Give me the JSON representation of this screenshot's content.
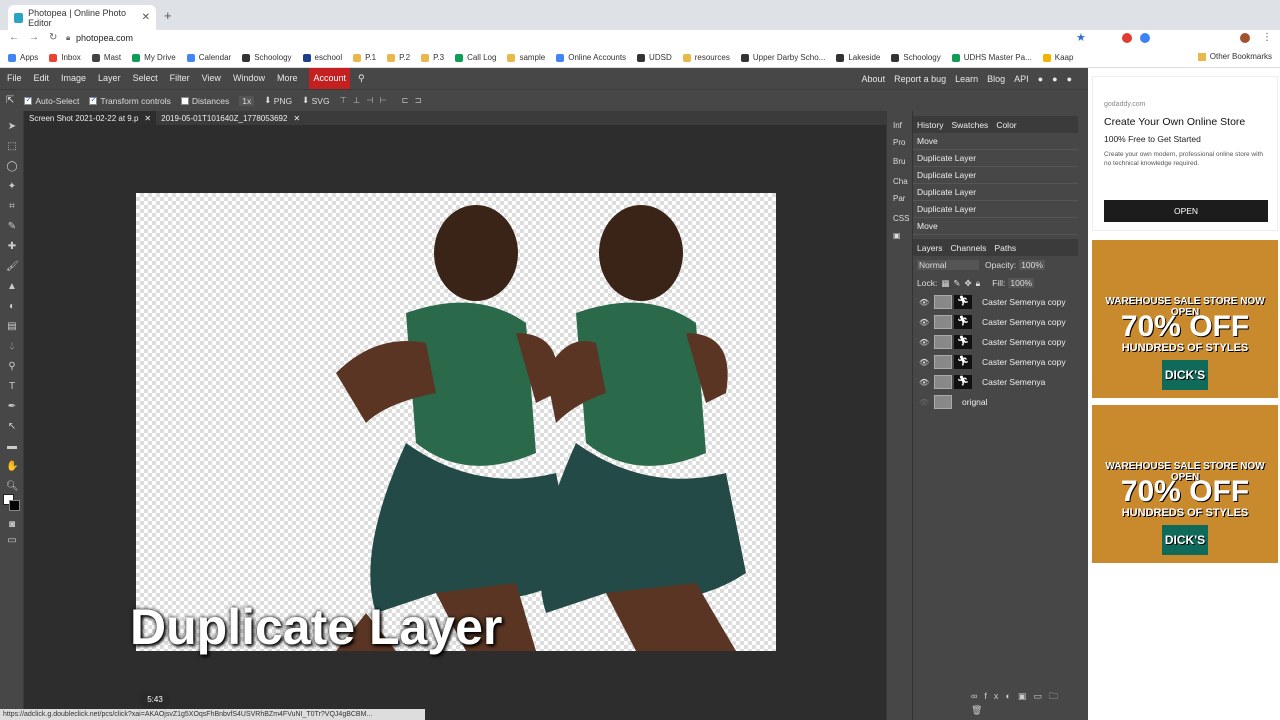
{
  "browser": {
    "tab_title": "Photopea | Online Photo Editor",
    "url": "photopea.com"
  },
  "bookmarks": [
    "Apps",
    "Inbox",
    "Mast",
    "My Drive",
    "Calendar",
    "Schoology",
    "eschool",
    "P.1",
    "P.2",
    "P.3",
    "Call Log",
    "sample",
    "Online Accounts",
    "UDSD",
    "resources",
    "Upper Darby Scho...",
    "Lakeside",
    "Schoology",
    "UDHS Master Pa...",
    "Kaap"
  ],
  "bookmarks_other": "Other Bookmarks",
  "menu": {
    "items": [
      "File",
      "Edit",
      "Image",
      "Layer",
      "Select",
      "Filter",
      "View",
      "Window",
      "More"
    ],
    "account": "Account",
    "right": [
      "About",
      "Report a bug",
      "Learn",
      "Blog",
      "API"
    ]
  },
  "options": {
    "auto_select": "Auto-Select",
    "transform": "Transform controls",
    "distances": "Distances",
    "zoom": "1x",
    "png": "PNG",
    "svg": "SVG"
  },
  "doc_tabs": [
    "Screen Shot 2021-02-22 at 9.p",
    "2019-05-01T101640Z_1778053692"
  ],
  "mini_panel": [
    "Inf",
    "Pro",
    "Bru",
    "Cha",
    "Par",
    "CSS"
  ],
  "history": {
    "tabs": [
      "History",
      "Swatches",
      "Color"
    ],
    "items": [
      "Move",
      "Duplicate Layer",
      "Duplicate Layer",
      "Duplicate Layer",
      "Duplicate Layer",
      "Move"
    ]
  },
  "layers": {
    "tabs": [
      "Layers",
      "Channels",
      "Paths"
    ],
    "blend": "Normal",
    "opacity_label": "Opacity:",
    "opacity": "100%",
    "lock_label": "Lock:",
    "fill_label": "Fill:",
    "fill": "100%",
    "items": [
      "Caster Semenya copy",
      "Caster Semenya copy",
      "Caster Semenya copy",
      "Caster Semenya copy",
      "Caster Semenya",
      "orignal"
    ]
  },
  "overlay_caption": "Duplicate Layer",
  "ad": {
    "domain": "godaddy.com",
    "title": "Create Your Own Online Store",
    "subtitle": "100% Free to Get Started",
    "body": "Create your own modern, professional online store with no technical knowledge required.",
    "button": "OPEN"
  },
  "ad_banner": {
    "line1": "WAREHOUSE SALE STORE NOW OPEN",
    "line2": "70% OFF",
    "line3": "HUNDREDS OF STYLES",
    "brand": "DICK'S"
  },
  "status_url": "https://adclick.g.doubleclick.net/pcs/click?xai=AKAOjsvZ1g5XOqsFhBnbvfS4USVRhBZm4FVuNI_T0Tr?VQJ4gBCBM...",
  "timer": "5:43"
}
